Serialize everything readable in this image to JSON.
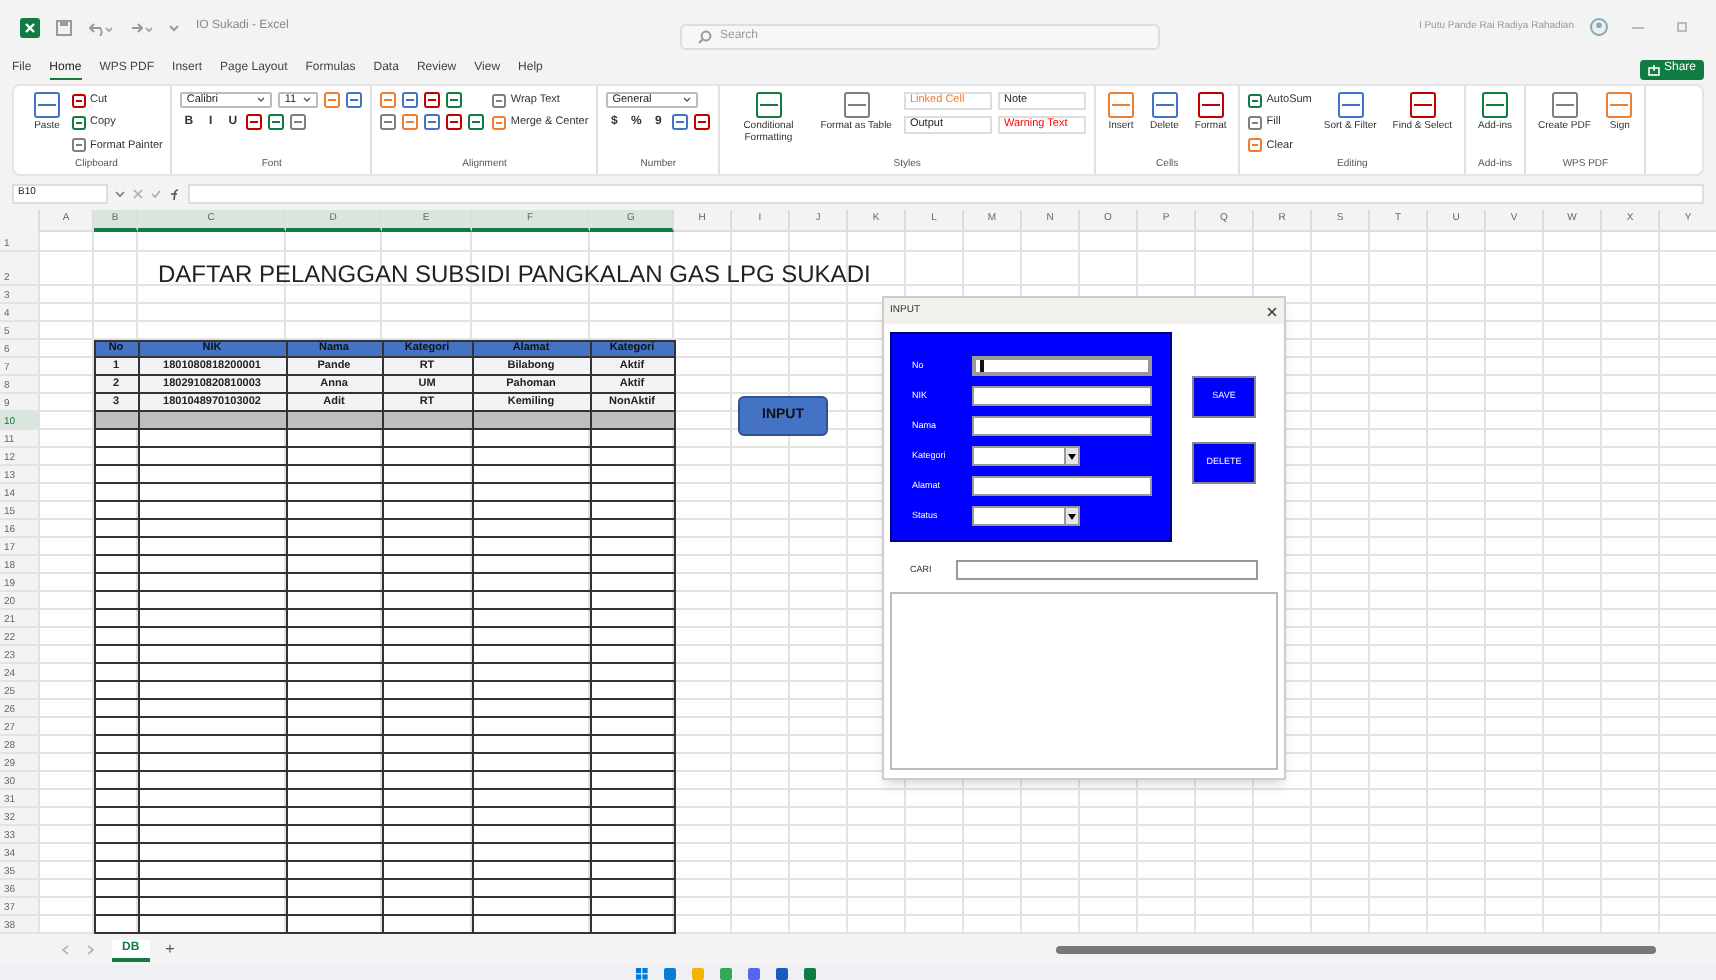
{
  "window": {
    "title": "IO Sukadi - Excel",
    "search_placeholder": "Search",
    "user": "I Putu Pande Rai Radiya Rahadian",
    "share": "Share"
  },
  "menu_tabs": [
    {
      "label": "File",
      "selected": false
    },
    {
      "label": "Home",
      "selected": true
    },
    {
      "label": "WPS PDF",
      "selected": false
    },
    {
      "label": "Insert",
      "selected": false
    },
    {
      "label": "Page Layout",
      "selected": false
    },
    {
      "label": "Formulas",
      "selected": false
    },
    {
      "label": "Data",
      "selected": false
    },
    {
      "label": "Review",
      "selected": false
    },
    {
      "label": "View",
      "selected": false
    },
    {
      "label": "Help",
      "selected": false
    }
  ],
  "ribbon": [
    {
      "name": "Clipboard",
      "columns": [
        [
          [
            {
              "kind": "big",
              "label": "Paste"
            }
          ]
        ],
        [
          [
            {
              "kind": "small",
              "label": "Cut"
            }
          ],
          [
            {
              "kind": "small",
              "label": "Copy"
            }
          ],
          [
            {
              "kind": "small",
              "label": "Format Painter"
            }
          ]
        ]
      ]
    },
    {
      "name": "Font",
      "columns": [
        [
          [
            {
              "kind": "dropdown",
              "label": "Calibri"
            },
            {
              "kind": "dropdown",
              "label": "11"
            },
            {
              "kind": "icon"
            },
            {
              "kind": "icon"
            }
          ],
          [
            {
              "kind": "glyph",
              "label": "B"
            },
            {
              "kind": "glyph",
              "label": "I"
            },
            {
              "kind": "glyph",
              "label": "U"
            },
            {
              "kind": "icon"
            },
            {
              "kind": "icon"
            },
            {
              "kind": "icon"
            }
          ]
        ]
      ]
    },
    {
      "name": "Alignment",
      "columns": [
        [
          [
            {
              "kind": "icon"
            },
            {
              "kind": "icon"
            },
            {
              "kind": "icon"
            },
            {
              "kind": "icon"
            }
          ],
          [
            {
              "kind": "icon"
            },
            {
              "kind": "icon"
            },
            {
              "kind": "icon"
            },
            {
              "kind": "icon"
            },
            {
              "kind": "icon"
            }
          ]
        ],
        [
          [
            {
              "kind": "small",
              "label": "Wrap Text"
            }
          ],
          [
            {
              "kind": "small",
              "label": "Merge & Center"
            }
          ]
        ]
      ]
    },
    {
      "name": "Number",
      "columns": [
        [
          [
            {
              "kind": "dropdown",
              "label": "General"
            }
          ],
          [
            {
              "kind": "glyph",
              "label": "$"
            },
            {
              "kind": "glyph",
              "label": "%"
            },
            {
              "kind": "glyph",
              "label": "9"
            },
            {
              "kind": "icon"
            },
            {
              "kind": "icon"
            }
          ]
        ]
      ]
    },
    {
      "name": "Styles",
      "columns": [
        [
          [
            {
              "kind": "big",
              "label": "Conditional Formatting"
            }
          ]
        ],
        [
          [
            {
              "kind": "big",
              "label": "Format as Table"
            }
          ]
        ],
        [
          [
            {
              "kind": "style",
              "label": "Linked Cell",
              "color": "#ed7d31"
            },
            {
              "kind": "style",
              "label": "Note"
            }
          ],
          [
            {
              "kind": "style",
              "label": "Output"
            },
            {
              "kind": "style",
              "label": "Warning Text",
              "color": "#ff0000"
            }
          ]
        ]
      ]
    },
    {
      "name": "Cells",
      "columns": [
        [
          [
            {
              "kind": "big",
              "label": "Insert"
            }
          ]
        ],
        [
          [
            {
              "kind": "big",
              "label": "Delete"
            }
          ]
        ],
        [
          [
            {
              "kind": "big",
              "label": "Format"
            }
          ]
        ]
      ]
    },
    {
      "name": "Editing",
      "columns": [
        [
          [
            {
              "kind": "small",
              "label": "AutoSum"
            }
          ],
          [
            {
              "kind": "small",
              "label": "Fill"
            }
          ],
          [
            {
              "kind": "small",
              "label": "Clear"
            }
          ]
        ],
        [
          [
            {
              "kind": "big",
              "label": "Sort & Filter"
            }
          ]
        ],
        [
          [
            {
              "kind": "big",
              "label": "Find & Select"
            }
          ]
        ]
      ]
    },
    {
      "name": "Add-ins",
      "columns": [
        [
          [
            {
              "kind": "big",
              "label": "Add-ins"
            }
          ]
        ]
      ]
    },
    {
      "name": "WPS PDF",
      "columns": [
        [
          [
            {
              "kind": "big",
              "label": "Create PDF"
            }
          ]
        ],
        [
          [
            {
              "kind": "big",
              "label": "Sign"
            }
          ]
        ]
      ]
    }
  ],
  "name_box": "B10",
  "sheet": {
    "title": "DAFTAR PELANGGAN SUBSIDI PANGKALAN GAS LPG SUKADI",
    "column_headers": [
      {
        "label": "A",
        "selected": false
      },
      {
        "label": "B",
        "selected": true
      },
      {
        "label": "C",
        "selected": true
      },
      {
        "label": "D",
        "selected": true
      },
      {
        "label": "E",
        "selected": true
      },
      {
        "label": "F",
        "selected": true
      },
      {
        "label": "G",
        "selected": true
      },
      {
        "label": "H",
        "selected": false
      },
      {
        "label": "I",
        "selected": false
      },
      {
        "label": "J",
        "selected": false
      },
      {
        "label": "K",
        "selected": false
      },
      {
        "label": "L",
        "selected": false
      },
      {
        "label": "M",
        "selected": false
      },
      {
        "label": "N",
        "selected": false
      },
      {
        "label": "O",
        "selected": false
      },
      {
        "label": "P",
        "selected": false
      },
      {
        "label": "Q",
        "selected": false
      },
      {
        "label": "R",
        "selected": false
      },
      {
        "label": "S",
        "selected": false
      },
      {
        "label": "T",
        "selected": false
      },
      {
        "label": "U",
        "selected": false
      },
      {
        "label": "V",
        "selected": false
      },
      {
        "label": "W",
        "selected": false
      },
      {
        "label": "X",
        "selected": false
      },
      {
        "label": "Y",
        "selected": false
      }
    ],
    "row_numbers": [
      {
        "label": "1",
        "selected": false
      },
      {
        "label": "2",
        "selected": false
      },
      {
        "label": "3",
        "selected": false
      },
      {
        "label": "4",
        "selected": false
      },
      {
        "label": "5",
        "selected": false
      },
      {
        "label": "6",
        "selected": false
      },
      {
        "label": "7",
        "selected": false
      },
      {
        "label": "8",
        "selected": false
      },
      {
        "label": "9",
        "selected": false
      },
      {
        "label": "10",
        "selected": true
      },
      {
        "label": "11",
        "selected": false
      },
      {
        "label": "12",
        "selected": false
      },
      {
        "label": "13",
        "selected": false
      },
      {
        "label": "14",
        "selected": false
      },
      {
        "label": "15",
        "selected": false
      },
      {
        "label": "16",
        "selected": false
      },
      {
        "label": "17",
        "selected": false
      },
      {
        "label": "18",
        "selected": false
      },
      {
        "label": "19",
        "selected": false
      },
      {
        "label": "20",
        "selected": false
      },
      {
        "label": "21",
        "selected": false
      },
      {
        "label": "22",
        "selected": false
      },
      {
        "label": "23",
        "selected": false
      },
      {
        "label": "24",
        "selected": false
      },
      {
        "label": "25",
        "selected": false
      },
      {
        "label": "26",
        "selected": false
      },
      {
        "label": "27",
        "selected": false
      },
      {
        "label": "28",
        "selected": false
      },
      {
        "label": "29",
        "selected": false
      },
      {
        "label": "30",
        "selected": false
      },
      {
        "label": "31",
        "selected": false
      },
      {
        "label": "32",
        "selected": false
      },
      {
        "label": "33",
        "selected": false
      },
      {
        "label": "34",
        "selected": false
      },
      {
        "label": "35",
        "selected": false
      },
      {
        "label": "36",
        "selected": false
      },
      {
        "label": "37",
        "selected": false
      },
      {
        "label": "38",
        "selected": false
      }
    ],
    "table": {
      "columns": [
        "No",
        "NIK",
        "Nama",
        "Kategori",
        "Alamat",
        "Kategori"
      ],
      "rows": [
        [
          "1",
          "1801080818200001",
          "Pande",
          "RT",
          "Bilabong",
          "Aktif"
        ],
        [
          "2",
          "1802910820810003",
          "Anna",
          "UM",
          "Pahoman",
          "Aktif"
        ],
        [
          "3",
          "1801048970103002",
          "Adit",
          "RT",
          "Kemiling",
          "NonAktif"
        ]
      ]
    },
    "input_button": "INPUT"
  },
  "dialog": {
    "title": "INPUT",
    "fields": [
      {
        "label": "No",
        "kind": "text",
        "focused": true
      },
      {
        "label": "NIK",
        "kind": "text",
        "focused": false
      },
      {
        "label": "Nama",
        "kind": "text",
        "focused": false
      },
      {
        "label": "Kategori",
        "kind": "combo",
        "focused": false
      },
      {
        "label": "Alamat",
        "kind": "text",
        "focused": false
      },
      {
        "label": "Status",
        "kind": "combo",
        "focused": false
      }
    ],
    "buttons": [
      "SAVE",
      "DELETE"
    ],
    "search_label": "CARI"
  },
  "sheet_tabs": [
    {
      "label": "DB",
      "selected": true
    }
  ],
  "add_sheet": "+"
}
